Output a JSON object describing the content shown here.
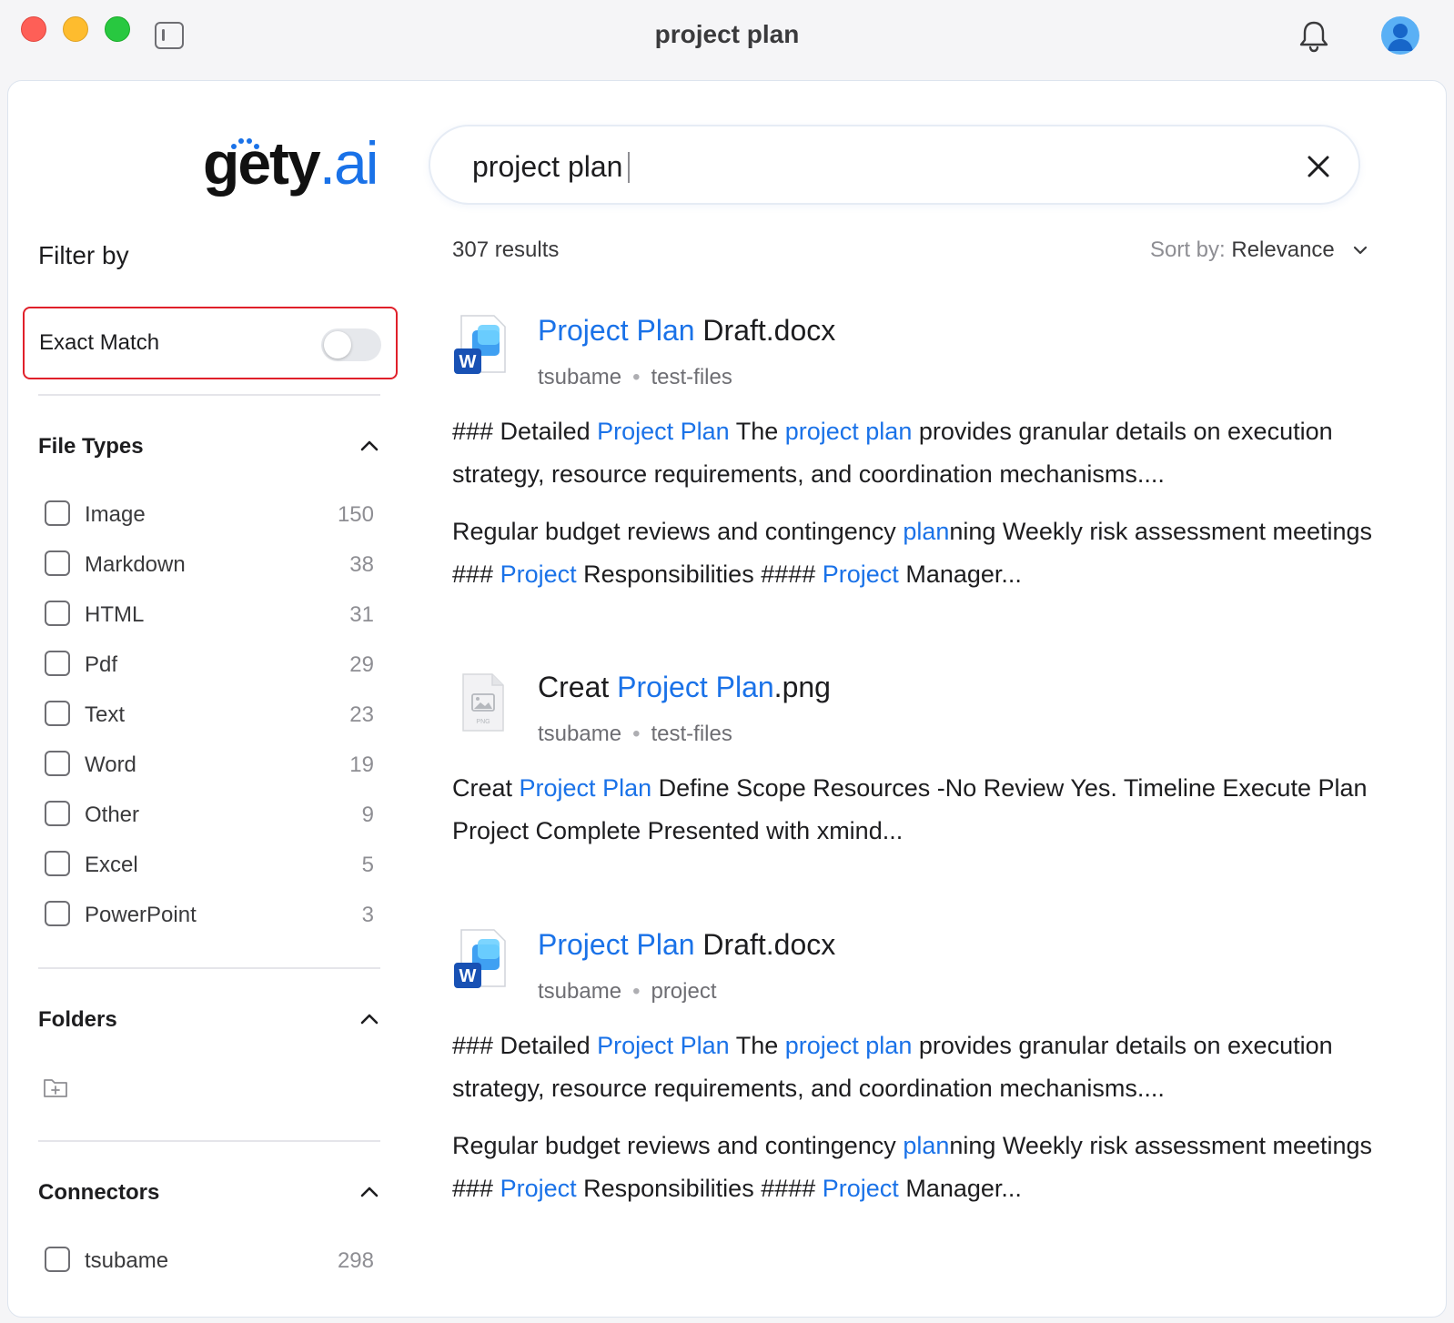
{
  "window": {
    "title": "project plan"
  },
  "brand": {
    "logo_main": "gety",
    "logo_dot": ".ai"
  },
  "filters": {
    "title": "Filter by",
    "exact_match": {
      "label": "Exact Match",
      "enabled": false
    },
    "file_types": {
      "title": "File Types",
      "items": [
        {
          "label": "Image",
          "count": "150"
        },
        {
          "label": "Markdown",
          "count": "38"
        },
        {
          "label": "HTML",
          "count": "31"
        },
        {
          "label": "Pdf",
          "count": "29"
        },
        {
          "label": "Text",
          "count": "23"
        },
        {
          "label": "Word",
          "count": "19"
        },
        {
          "label": "Other",
          "count": "9"
        },
        {
          "label": "Excel",
          "count": "5"
        },
        {
          "label": "PowerPoint",
          "count": "3"
        }
      ]
    },
    "folders": {
      "title": "Folders"
    },
    "connectors": {
      "title": "Connectors",
      "items": [
        {
          "label": "tsubame",
          "count": "298"
        }
      ]
    }
  },
  "search": {
    "value": "project plan"
  },
  "results_summary": {
    "count": "307 results",
    "sort_label": "Sort by:",
    "sort_value": "Relevance"
  },
  "results": [
    {
      "icon": "word-file-icon",
      "title": [
        {
          "t": "Project Plan",
          "hl": true
        },
        {
          "t": " Draft.docx",
          "hl": false
        }
      ],
      "source": "tsubame",
      "folder": "test-files",
      "snippets": [
        [
          {
            "t": "### Detailed ",
            "hl": false
          },
          {
            "t": "Project Plan",
            "hl": true
          },
          {
            "t": " The ",
            "hl": false
          },
          {
            "t": "project plan",
            "hl": true
          },
          {
            "t": " provides granular details on execution strategy, resource requirements, and coordination mechanisms....",
            "hl": false
          }
        ],
        [
          {
            "t": "Regular budget reviews and contingency ",
            "hl": false
          },
          {
            "t": "plan",
            "hl": true
          },
          {
            "t": "ning Weekly risk assessment meetings ### ",
            "hl": false
          },
          {
            "t": "Project",
            "hl": true
          },
          {
            "t": " Responsibilities #### ",
            "hl": false
          },
          {
            "t": "Project",
            "hl": true
          },
          {
            "t": " Manager...",
            "hl": false
          }
        ]
      ]
    },
    {
      "icon": "png-file-icon",
      "title": [
        {
          "t": "Creat ",
          "hl": false
        },
        {
          "t": "Project Plan",
          "hl": true
        },
        {
          "t": ".png",
          "hl": false
        }
      ],
      "source": "tsubame",
      "folder": "test-files",
      "snippets": [
        [
          {
            "t": "Creat ",
            "hl": false
          },
          {
            "t": "Project Plan",
            "hl": true
          },
          {
            "t": " Define Scope Resources -No Review Yes. Timeline Execute Plan Project Complete Presented with xmind...",
            "hl": false
          }
        ]
      ]
    },
    {
      "icon": "word-file-icon",
      "title": [
        {
          "t": "Project Plan",
          "hl": true
        },
        {
          "t": " Draft.docx",
          "hl": false
        }
      ],
      "source": "tsubame",
      "folder": "project",
      "snippets": [
        [
          {
            "t": "### Detailed ",
            "hl": false
          },
          {
            "t": "Project Plan",
            "hl": true
          },
          {
            "t": " The ",
            "hl": false
          },
          {
            "t": "project plan",
            "hl": true
          },
          {
            "t": " provides granular details on execution strategy, resource requirements, and coordination mechanisms....",
            "hl": false
          }
        ],
        [
          {
            "t": "Regular budget reviews and contingency ",
            "hl": false
          },
          {
            "t": "plan",
            "hl": true
          },
          {
            "t": "ning Weekly risk assessment meetings ### ",
            "hl": false
          },
          {
            "t": "Project",
            "hl": true
          },
          {
            "t": " Responsibilities #### ",
            "hl": false
          },
          {
            "t": "Project",
            "hl": true
          },
          {
            "t": " Manager...",
            "hl": false
          }
        ]
      ]
    }
  ],
  "colors": {
    "accent": "#1a72e8",
    "exact_match_border": "#e0202a"
  }
}
